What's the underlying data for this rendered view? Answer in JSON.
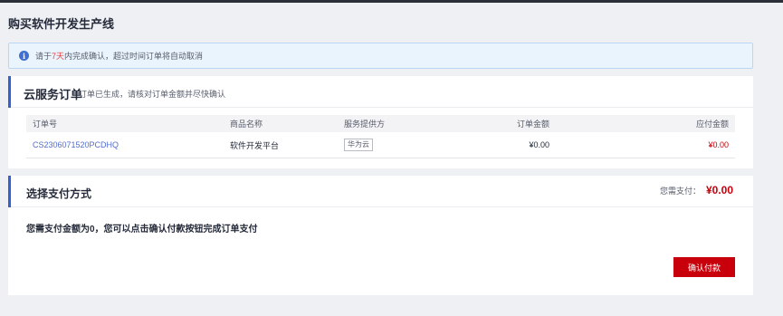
{
  "page_title": "购买软件开发生产线",
  "notice": {
    "prefix": "请于",
    "highlight": "7天",
    "suffix": "内完成确认，超过时间订单将自动取消",
    "icon": "info-icon"
  },
  "order_section": {
    "title": "云服务订单",
    "subtitle": "订单已生成，请核对订单金额并尽快确认",
    "columns": [
      "订单号",
      "商品名称",
      "服务提供方",
      "订单金额",
      "应付金额"
    ],
    "rows": [
      {
        "order_id": "CS2306071520PCDHQ",
        "product": "软件开发平台",
        "provider": "华为云",
        "order_amount": "¥0.00",
        "payable_amount": "¥0.00"
      }
    ]
  },
  "payment_section": {
    "title": "选择支付方式",
    "total_label": "您需支付：",
    "total_amount": "¥0.00",
    "message": "您需支付金额为0，您可以点击确认付款按钮完成订单支付",
    "confirm_button": "确认付款"
  },
  "colors": {
    "accent_blue": "#3560d0",
    "price_red": "#c7000b",
    "link_blue": "#526ecc",
    "page_bg": "#eff0f3"
  }
}
